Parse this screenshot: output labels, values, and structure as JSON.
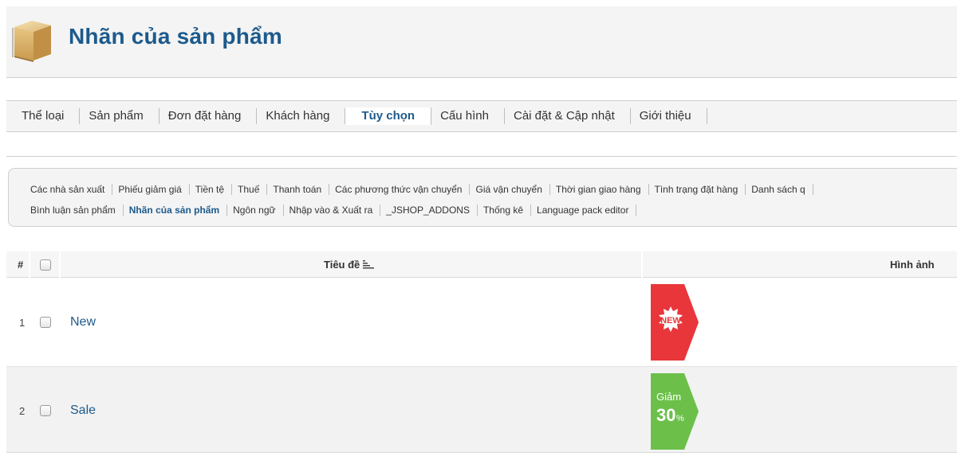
{
  "header": {
    "title": "Nhãn của sản phẩm",
    "icon": "box-icon"
  },
  "main_menu": [
    {
      "label": "Thể loại",
      "active": false
    },
    {
      "label": "Sản phẩm",
      "active": false
    },
    {
      "label": "Đơn đặt hàng",
      "active": false
    },
    {
      "label": "Khách hàng",
      "active": false
    },
    {
      "label": "Tùy chọn",
      "active": true
    },
    {
      "label": "Cấu hình",
      "active": false
    },
    {
      "label": "Cài đặt & Cập nhật",
      "active": false
    },
    {
      "label": "Giới thiệu",
      "active": false
    }
  ],
  "sub_menu": {
    "row1": [
      "Các nhà sản xuất",
      "Phiếu giảm giá",
      "Tiền tệ",
      "Thuế",
      "Thanh toán",
      "Các phương thức vận chuyển",
      "Giá vận chuyển",
      "Thời gian giao hàng",
      "Tình trạng đặt hàng",
      "Danh sách q"
    ],
    "row2": [
      {
        "label": "Bình luận sản phẩm",
        "active": false
      },
      {
        "label": "Nhãn của sản phẩm",
        "active": true
      },
      {
        "label": "Ngôn ngữ",
        "active": false
      },
      {
        "label": "Nhập vào & Xuất ra",
        "active": false
      },
      {
        "label": "_JSHOP_ADDONS",
        "active": false
      },
      {
        "label": "Thống kê",
        "active": false
      },
      {
        "label": "Language pack editor",
        "active": false
      }
    ]
  },
  "table": {
    "headers": {
      "num": "#",
      "title": "Tiêu đề",
      "image": "Hình ảnh"
    },
    "rows": [
      {
        "num": "1",
        "title": "New",
        "label_text": "NEW",
        "label_color": "#e8363a"
      },
      {
        "num": "2",
        "title": "Sale",
        "label_line1": "Giảm",
        "label_line2": "30",
        "label_pct": "%",
        "label_color": "#6cc04a"
      }
    ]
  },
  "colors": {
    "accent": "#1d5a8c",
    "panel": "#f4f4f4",
    "border": "#cfcfcf"
  }
}
